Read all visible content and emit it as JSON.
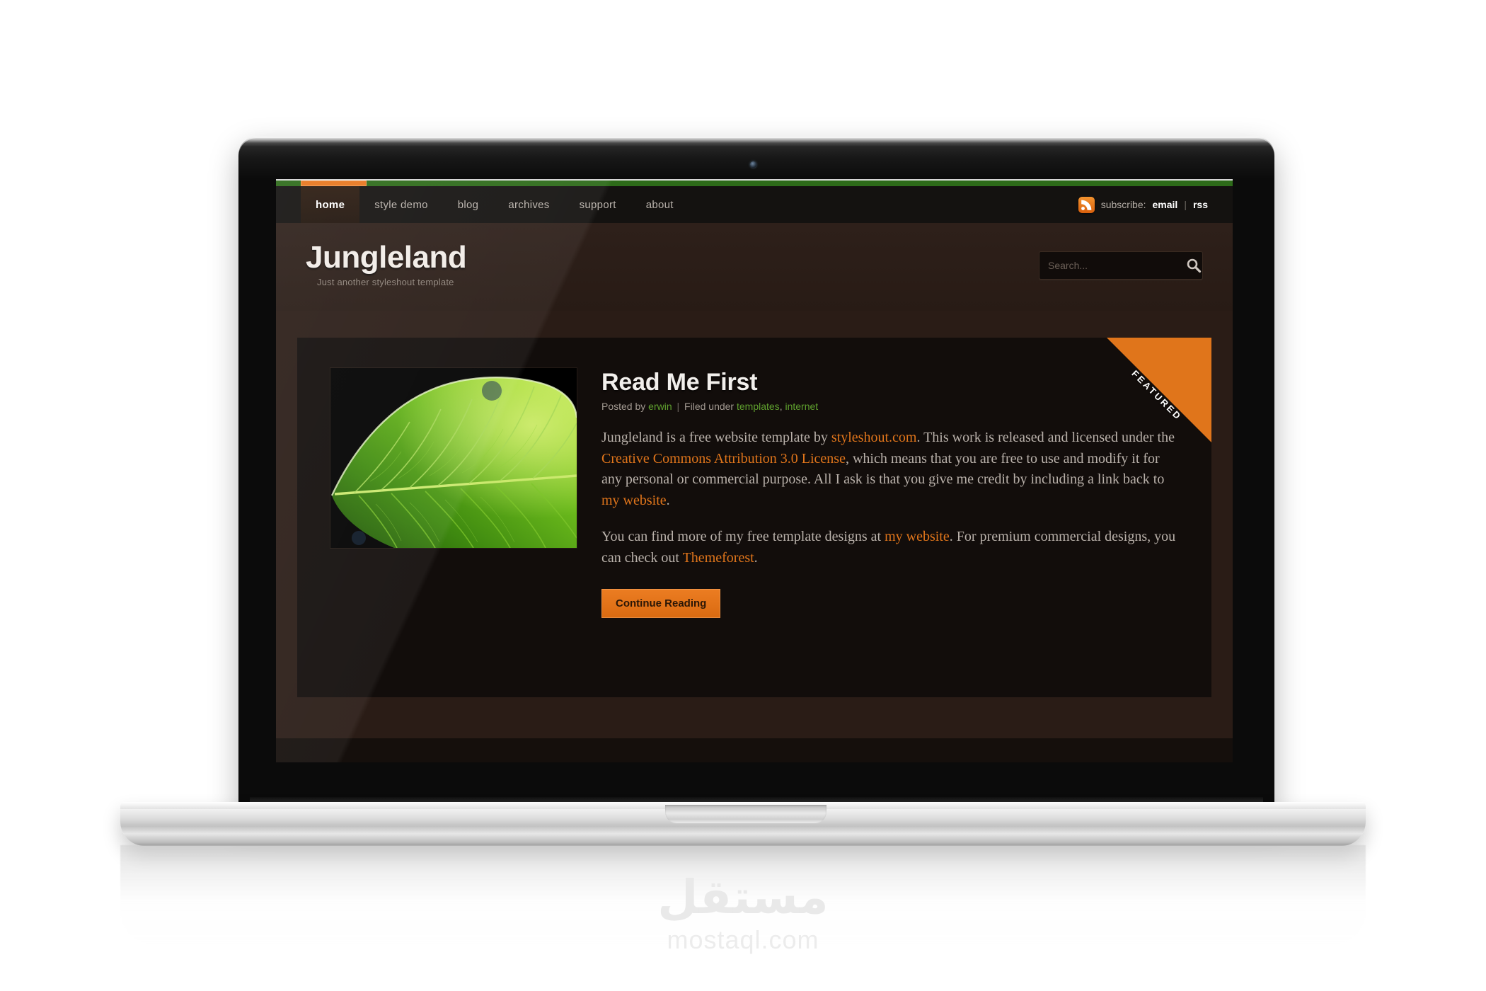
{
  "site": {
    "brand": {
      "logo": "Jungleland",
      "tagline": "Just another styleshout template"
    },
    "nav": {
      "items": [
        {
          "label": "home",
          "active": true
        },
        {
          "label": "style demo",
          "active": false
        },
        {
          "label": "blog",
          "active": false
        },
        {
          "label": "archives",
          "active": false
        },
        {
          "label": "support",
          "active": false
        },
        {
          "label": "about",
          "active": false
        }
      ]
    },
    "subscribe": {
      "icon": "rss-icon",
      "label": "subscribe:",
      "email_link": "email",
      "separator": "|",
      "rss_link": "rss"
    },
    "search": {
      "placeholder": "Search...",
      "value": "",
      "icon": "search-icon"
    },
    "article": {
      "ribbon": "FEATURED",
      "title": "Read Me First",
      "meta": {
        "posted_by_label": "Posted by",
        "author": "erwin",
        "separator": "|",
        "filed_under_label": "Filed under",
        "tags": [
          "templates",
          "internet"
        ]
      },
      "thumbnail_alt": "green-leaf-photo",
      "paragraph_1": {
        "part_1": "Jungleland is a free website template by ",
        "link_1": "styleshout.com",
        "part_2": ". This work is released and licensed under the ",
        "link_2": "Creative Commons Attribution 3.0 License",
        "part_3": ", which means that you are free to use and modify it for any personal or commercial purpose. All I ask is that you give me credit by including a link back to ",
        "link_3": "my website",
        "part_4": "."
      },
      "paragraph_2": {
        "part_1": "You can find more of my free template designs at ",
        "link_1": "my website",
        "part_2": ". For premium commercial designs, you can check out ",
        "link_2": "Themeforest",
        "part_3": "."
      },
      "button": "Continue Reading"
    },
    "colors": {
      "accent_orange": "#e0751b",
      "accent_green": "#2d6b19",
      "link_green": "#5fa02e",
      "panel_bg": "#120d0b",
      "page_bg": "#2a1c16"
    }
  },
  "watermark": {
    "arabic": "مستقل",
    "domain": "mostaql.com"
  }
}
